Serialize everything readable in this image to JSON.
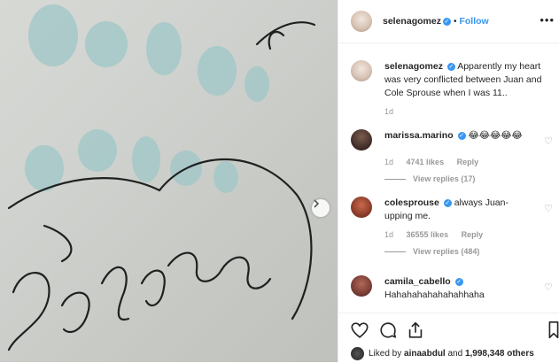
{
  "header": {
    "username": "selenagomez",
    "follow_label": "Follow",
    "dot": "•",
    "more": "•••"
  },
  "caption": {
    "username": "selenagomez",
    "text": "Apparently my heart was very conflicted between Juan and Cole Sprouse when I was 11..",
    "time": "1d"
  },
  "comments": [
    {
      "username": "marissa.marino",
      "verified": true,
      "text": "😂😂😂😂😂",
      "time": "1d",
      "likes": "4741 likes",
      "reply": "Reply",
      "view_replies": "View replies (17)"
    },
    {
      "username": "colesprouse",
      "verified": true,
      "text": "always Juan-upping me.",
      "time": "1d",
      "likes": "36555 likes",
      "reply": "Reply",
      "view_replies": "View replies (484)"
    },
    {
      "username": "camila_cabello",
      "verified": true,
      "text": "Hahahahahahahahhaha"
    }
  ],
  "likes": {
    "liker": "ainaabdul",
    "others": "1,998,348 others",
    "prefix": "Liked by",
    "and": "and"
  },
  "icons": {
    "heart": "heart-icon",
    "comment": "comment-icon",
    "share": "share-icon",
    "next": "chevron-right-icon"
  }
}
